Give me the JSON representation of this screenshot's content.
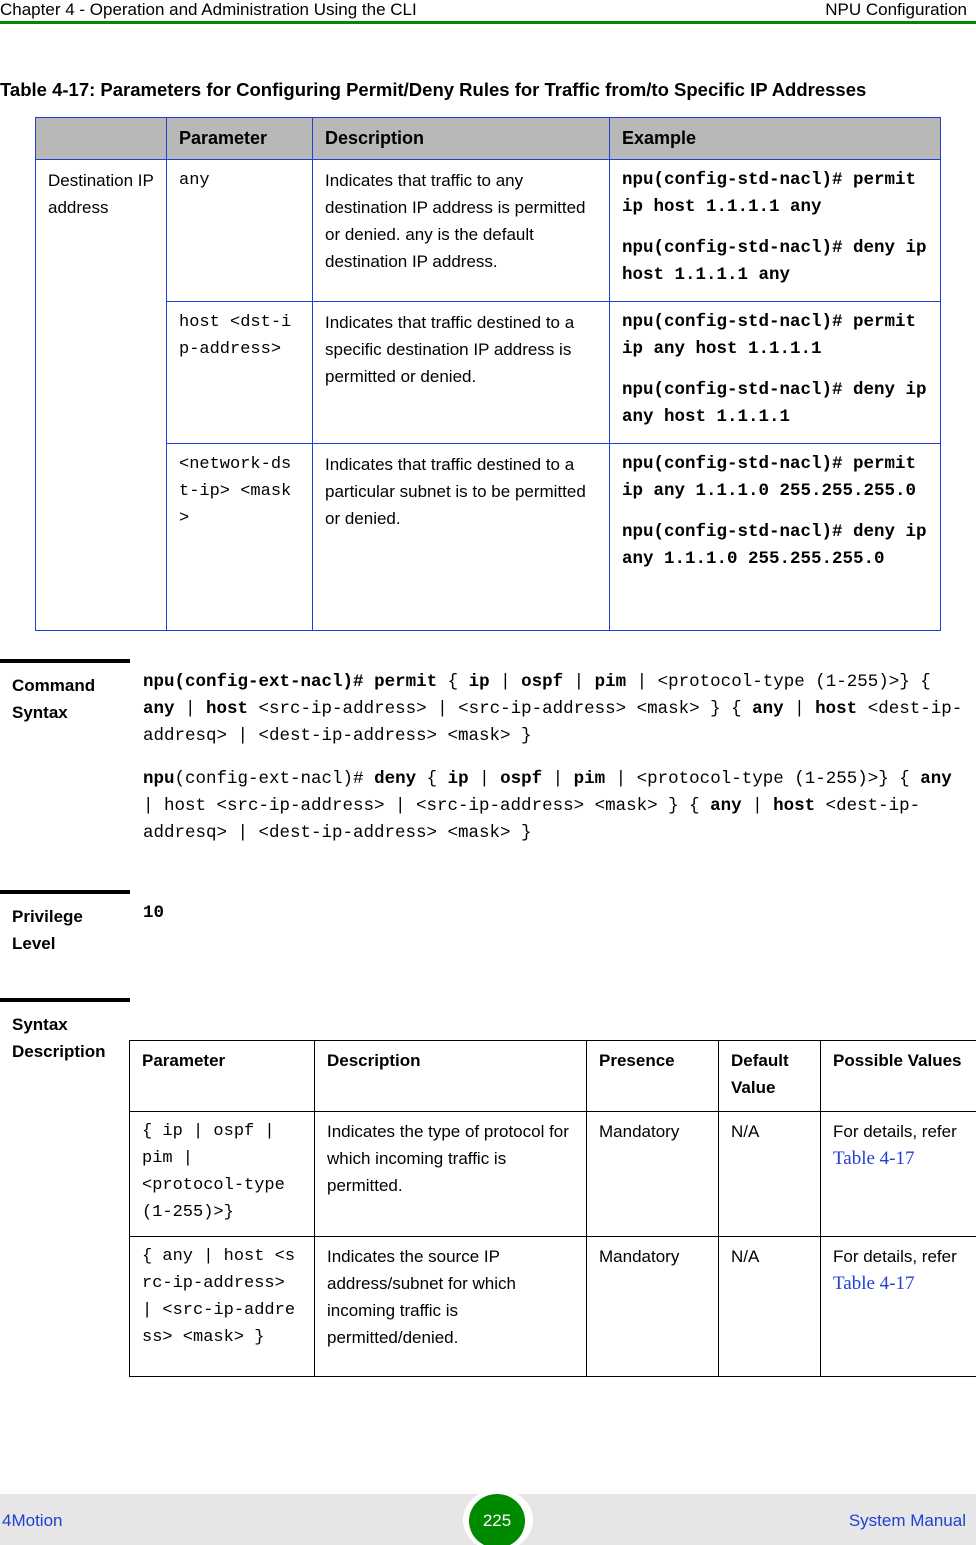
{
  "header": {
    "chapter": "Chapter 4 - Operation and Administration Using the CLI",
    "section": "NPU Configuration",
    "rule_color": "#008a00"
  },
  "table1": {
    "caption": "Table 4-17: Parameters for Configuring Permit/Deny Rules for Traffic from/to Specific IP Addresses",
    "columns": [
      "",
      "Parameter",
      "Description",
      "Example"
    ],
    "group_label": "Destination IP address",
    "rows": [
      {
        "parameter": "any",
        "description": "Indicates that traffic to any destination IP address is permitted or denied. any is the default destination IP address.",
        "examples": [
          "npu(config-std-nacl)# permit ip host 1.1.1.1  any",
          "npu(config-std-nacl)# deny ip host 1.1.1.1  any"
        ]
      },
      {
        "parameter": "host <dst-ip-address>",
        "description": "Indicates that traffic destined to a specific destination IP address is permitted or denied.",
        "examples": [
          "npu(config-std-nacl)# permit ip  any host 1.1.1.1",
          "npu(config-std-nacl)# deny ip any host 1.1.1.1"
        ]
      },
      {
        "parameter": "<network-dst-ip> <mask>",
        "description": "Indicates that traffic destined to a particular subnet is to be permitted or denied.",
        "examples": [
          "npu(config-std-nacl)# permit ip  any  1.1.1.0 255.255.255.0",
          "npu(config-std-nacl)# deny ip  any  1.1.1.0 255.255.255.0"
        ]
      }
    ]
  },
  "command_syntax": {
    "label": "Command Syntax",
    "permit": {
      "prompt": "npu(config-ext-nacl)#",
      "keyword": "permit",
      "rest": [
        " { ",
        "ip",
        " | ",
        "ospf",
        " | ",
        "pim",
        " | <protocol-type (1-255)>} { ",
        "any",
        " | ",
        "host",
        " <src-ip-address> | <src-ip-address> <mask> } { ",
        "any",
        " | ",
        "host",
        " <dest-ip-addresq> | <dest-ip-address> <mask> }"
      ]
    },
    "deny": {
      "prompt_bold": "npu",
      "prompt_rest": "(config-ext-nacl)#",
      "keyword": "deny",
      "rest": [
        " { ",
        "ip",
        " | ",
        "ospf",
        " | ",
        "pim",
        " | <protocol-type (1-255)>} { ",
        "any",
        " | host <src-ip-address> | <src-ip-address> <mask> } { ",
        "any",
        " | ",
        "host",
        " <dest-ip-addresq> | <dest-ip-address> <mask> }"
      ]
    }
  },
  "privilege": {
    "label": "Privilege Level",
    "value": "10"
  },
  "syntax_description": {
    "label": "Syntax Description",
    "columns": [
      "Parameter",
      "Description",
      "Presence",
      "Default Value",
      "Possible Values"
    ],
    "rows": [
      {
        "parameter": "{ ip | ospf | pim | <protocol-type (1-255)>}",
        "description": "Indicates the type of protocol for which incoming traffic is permitted.",
        "presence": "Mandatory",
        "default": "N/A",
        "possible_prefix": "For details, refer",
        "possible_link": "Table 4-17"
      },
      {
        "parameter": "{ any | host <src-ip-address> | <src-ip-address> <mask> }",
        "description": "Indicates the source IP address/subnet for which incoming traffic is permitted/denied.",
        "presence": "Mandatory",
        "default": "N/A",
        "possible_prefix": "For details, refer",
        "possible_link": "Table 4-17"
      }
    ]
  },
  "footer": {
    "product": "4Motion",
    "page_number": "225",
    "doc": "System Manual",
    "badge_color": "#008a00",
    "link_color": "#1f3fd6"
  }
}
